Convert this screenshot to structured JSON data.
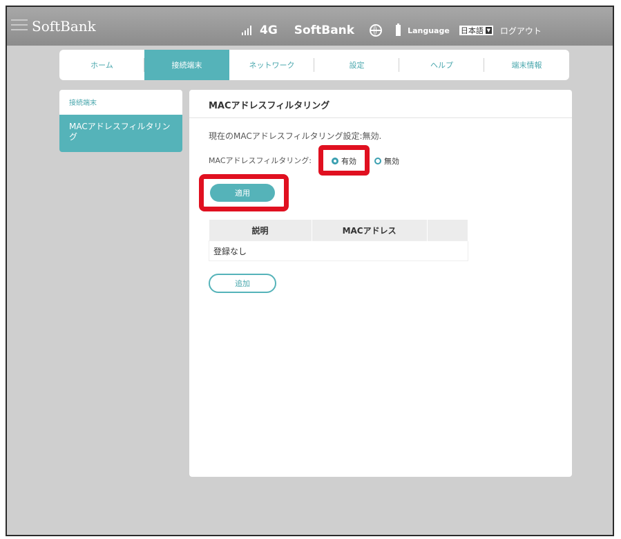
{
  "header": {
    "brand": "SoftBank",
    "network_type": "4G",
    "carrier": "SoftBank",
    "language_label": "Language",
    "language_value": "日本語",
    "logout": "ログアウト"
  },
  "tabs": [
    {
      "label": "ホーム",
      "active": false
    },
    {
      "label": "接続端末",
      "active": true
    },
    {
      "label": "ネットワーク",
      "active": false
    },
    {
      "label": "設定",
      "active": false
    },
    {
      "label": "ヘルプ",
      "active": false
    },
    {
      "label": "端末情報",
      "active": false
    }
  ],
  "sidebar": {
    "items": [
      {
        "label": "接続端末",
        "active": false
      },
      {
        "label": "MACアドレスフィルタリング",
        "active": true
      }
    ]
  },
  "main": {
    "title": "MACアドレスフィルタリング",
    "current_status": "現在のMACアドレスフィルタリング設定:無効.",
    "filter_label": "MACアドレスフィルタリング:",
    "options": [
      {
        "label": "有効",
        "selected": true
      },
      {
        "label": "無効",
        "selected": false
      }
    ],
    "apply_button": "適用",
    "table": {
      "columns": [
        "説明",
        "MACアドレス",
        ""
      ],
      "empty_text": "登録なし"
    },
    "add_button": "追加"
  },
  "colors": {
    "accent": "#55b3b9",
    "highlight": "#e01020",
    "header_bg": "#9a9a9a"
  }
}
